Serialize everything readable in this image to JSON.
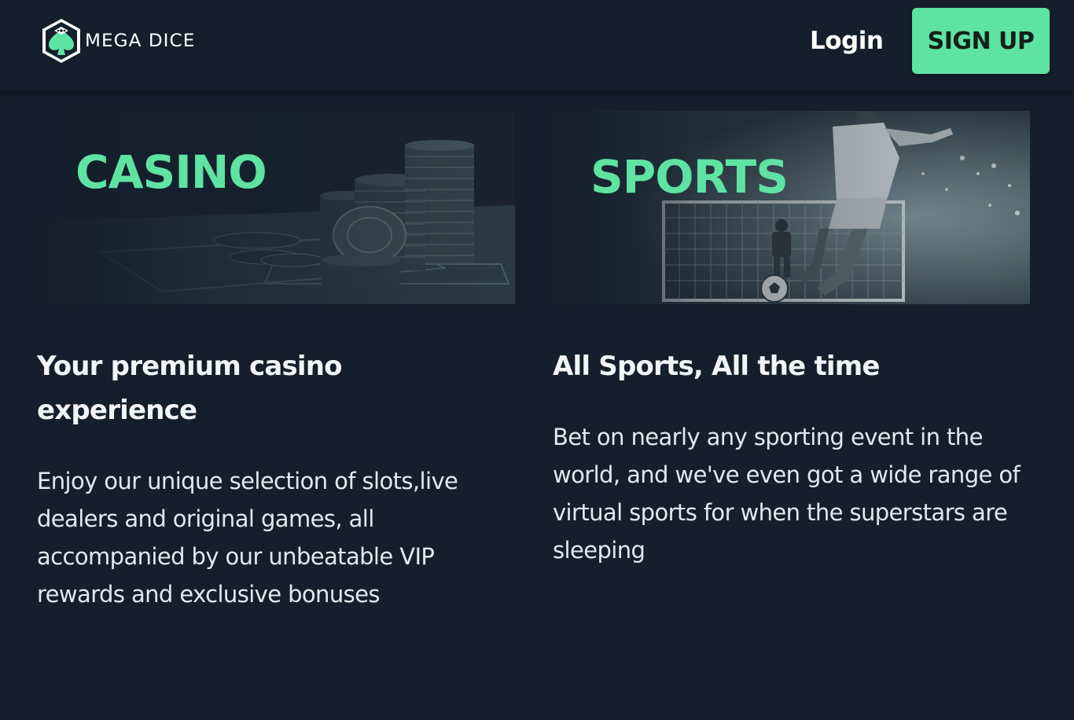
{
  "header": {
    "logo_text": "MEGA DICE",
    "login_label": "Login",
    "signup_label": "SIGN UP"
  },
  "cards": {
    "casino": {
      "banner_title": "CASINO",
      "heading": "Your premium casino experience",
      "body": "Enjoy our unique selection of slots,live dealers and original games, all accompanied by our unbeatable VIP rewards and exclusive bonuses"
    },
    "sports": {
      "banner_title": "SPORTS",
      "heading": "All Sports, All the time",
      "body": "Bet on nearly any sporting event in the world, and we've even got a wide range of virtual sports for when the superstars are sleeping"
    }
  },
  "colors": {
    "background": "#141e2c",
    "accent": "#5ee3a2",
    "text": "#e8ecf1"
  },
  "icons": {
    "logo": "dice-spade-logo-icon"
  }
}
